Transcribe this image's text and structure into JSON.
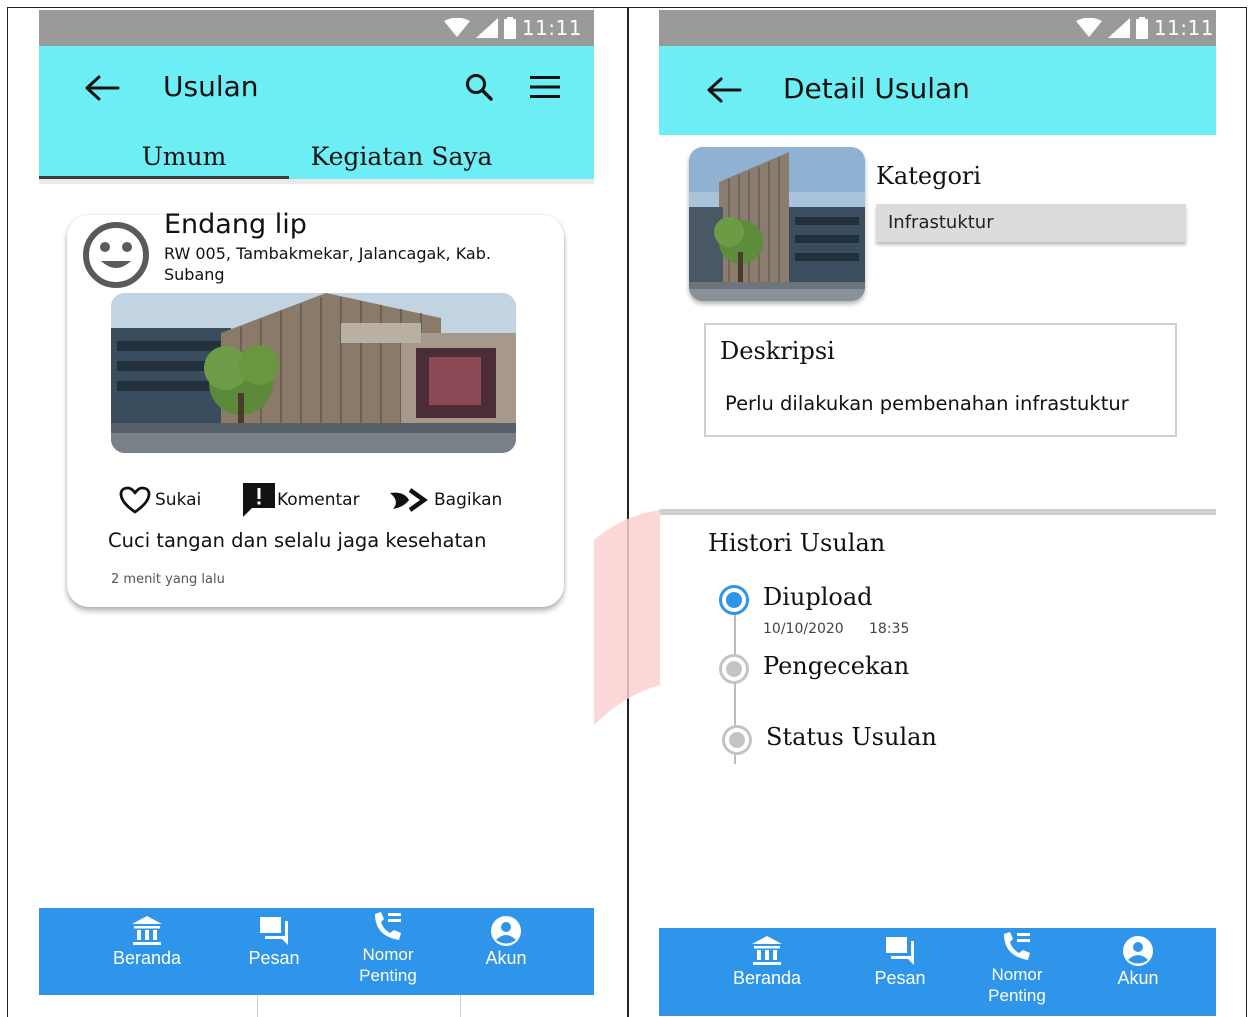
{
  "left_screen": {
    "status_bar": {
      "time": "11:11"
    },
    "app_bar": {
      "title": "Usulan",
      "back_icon": "arrow-left-icon",
      "search_icon": "search-icon",
      "menu_icon": "hamburger-menu-icon"
    },
    "tabs": [
      {
        "label": "Umum",
        "selected": true
      },
      {
        "label": "Kegiatan Saya",
        "selected": false
      }
    ],
    "post": {
      "author": "Endang lip",
      "address": "RW 005, Tambakmekar, Jalancagak, Kab. Subang",
      "actions": {
        "like": "Sukai",
        "comment": "Komentar",
        "share": "Bagikan"
      },
      "text": "Cuci tangan dan selalu jaga kesehatan",
      "time_ago": "2 menit yang lalu"
    },
    "bottom_nav": [
      {
        "label": "Beranda",
        "icon": "bank-icon"
      },
      {
        "label": "Pesan",
        "icon": "message-icon"
      },
      {
        "label": "Nomor\nPenting",
        "icon": "phone-book-icon"
      },
      {
        "label": "Akun",
        "icon": "account-icon"
      }
    ]
  },
  "right_screen": {
    "status_bar": {
      "time": "11:11"
    },
    "app_bar": {
      "title": "Detail Usulan",
      "back_icon": "arrow-left-icon"
    },
    "kategori": {
      "label": "Kategori",
      "value": "Infrastuktur"
    },
    "deskripsi": {
      "label": "Deskripsi",
      "text": "Perlu dilakukan pembenahan infrastuktur"
    },
    "histori": {
      "title": "Histori Usulan",
      "steps": [
        {
          "label": "Diupload",
          "date": "10/10/2020",
          "time": "18:35",
          "active": true
        },
        {
          "label": "Pengecekan",
          "active": false
        },
        {
          "label": "Status Usulan",
          "active": false
        }
      ]
    },
    "bottom_nav": [
      {
        "label": "Beranda",
        "icon": "bank-icon"
      },
      {
        "label": "Pesan",
        "icon": "message-icon"
      },
      {
        "label": "Nomor\nPenting",
        "icon": "phone-book-icon"
      },
      {
        "label": "Akun",
        "icon": "account-icon"
      }
    ]
  },
  "colors": {
    "appbar": "#6deef5",
    "bottom_nav": "#2e95ea",
    "status_bar": "#9a9a9a",
    "active_step": "#2e95ea",
    "inactive_step": "#bdbdbd"
  }
}
